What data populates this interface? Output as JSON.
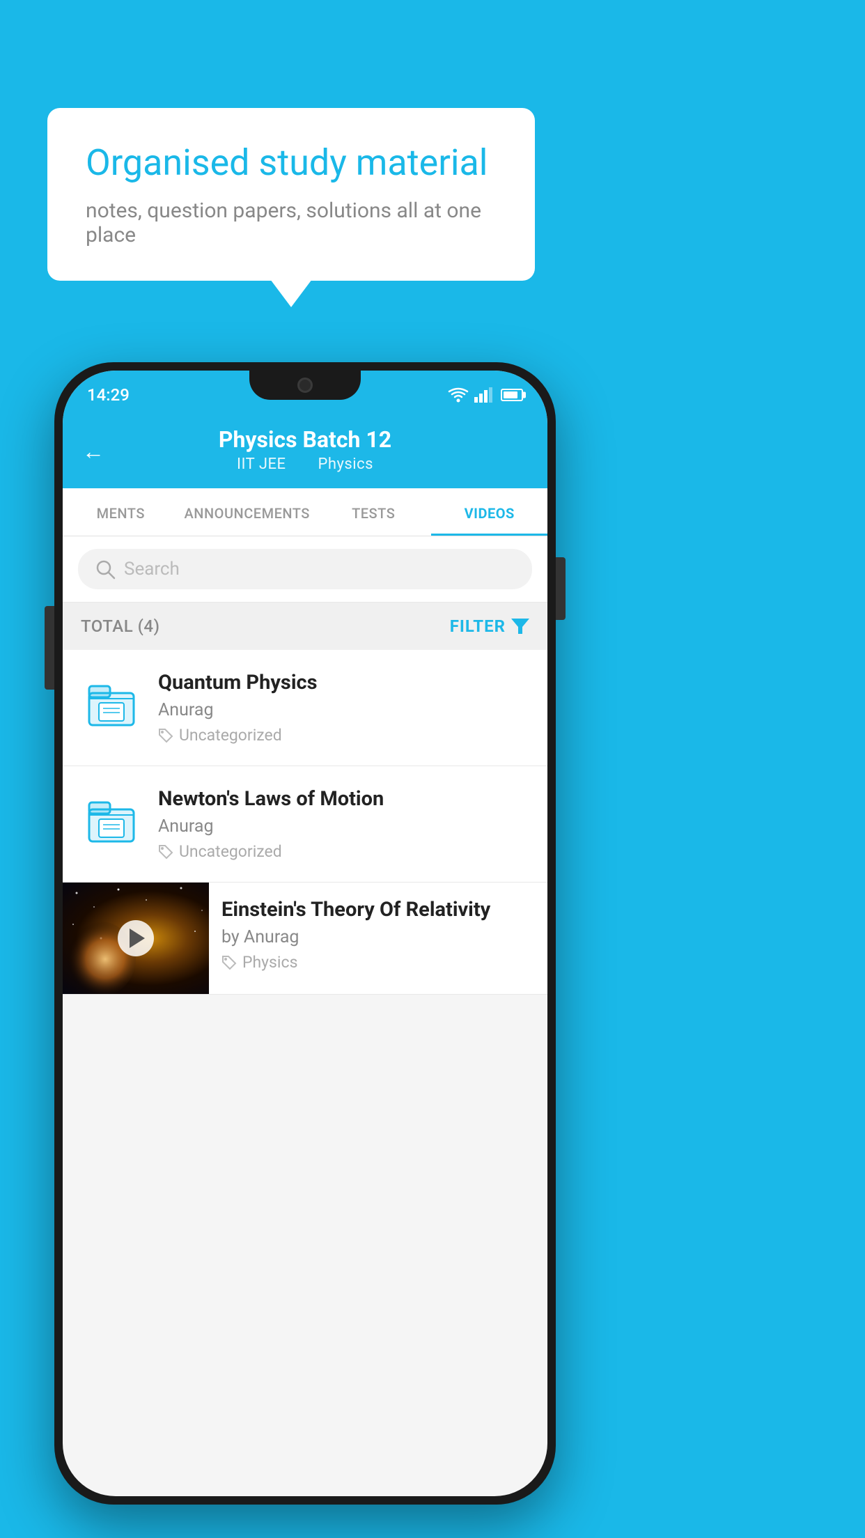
{
  "background_color": "#1ab8e8",
  "speech_bubble": {
    "title": "Organised study material",
    "subtitle": "notes, question papers, solutions all at one place"
  },
  "phone": {
    "status_bar": {
      "time": "14:29",
      "icons": [
        "wifi",
        "signal",
        "battery"
      ]
    },
    "header": {
      "back_label": "←",
      "title": "Physics Batch 12",
      "subtitle_left": "IIT JEE",
      "subtitle_right": "Physics"
    },
    "tabs": [
      {
        "label": "MENTS",
        "active": false
      },
      {
        "label": "ANNOUNCEMENTS",
        "active": false
      },
      {
        "label": "TESTS",
        "active": false
      },
      {
        "label": "VIDEOS",
        "active": true
      }
    ],
    "search": {
      "placeholder": "Search"
    },
    "filter_bar": {
      "total_label": "TOTAL (4)",
      "filter_label": "FILTER"
    },
    "videos": [
      {
        "id": 1,
        "title": "Quantum Physics",
        "author": "Anurag",
        "tag": "Uncategorized",
        "type": "folder"
      },
      {
        "id": 2,
        "title": "Newton's Laws of Motion",
        "author": "Anurag",
        "tag": "Uncategorized",
        "type": "folder"
      },
      {
        "id": 3,
        "title": "Einstein's Theory Of Relativity",
        "author": "by Anurag",
        "tag": "Physics",
        "type": "video"
      }
    ]
  }
}
